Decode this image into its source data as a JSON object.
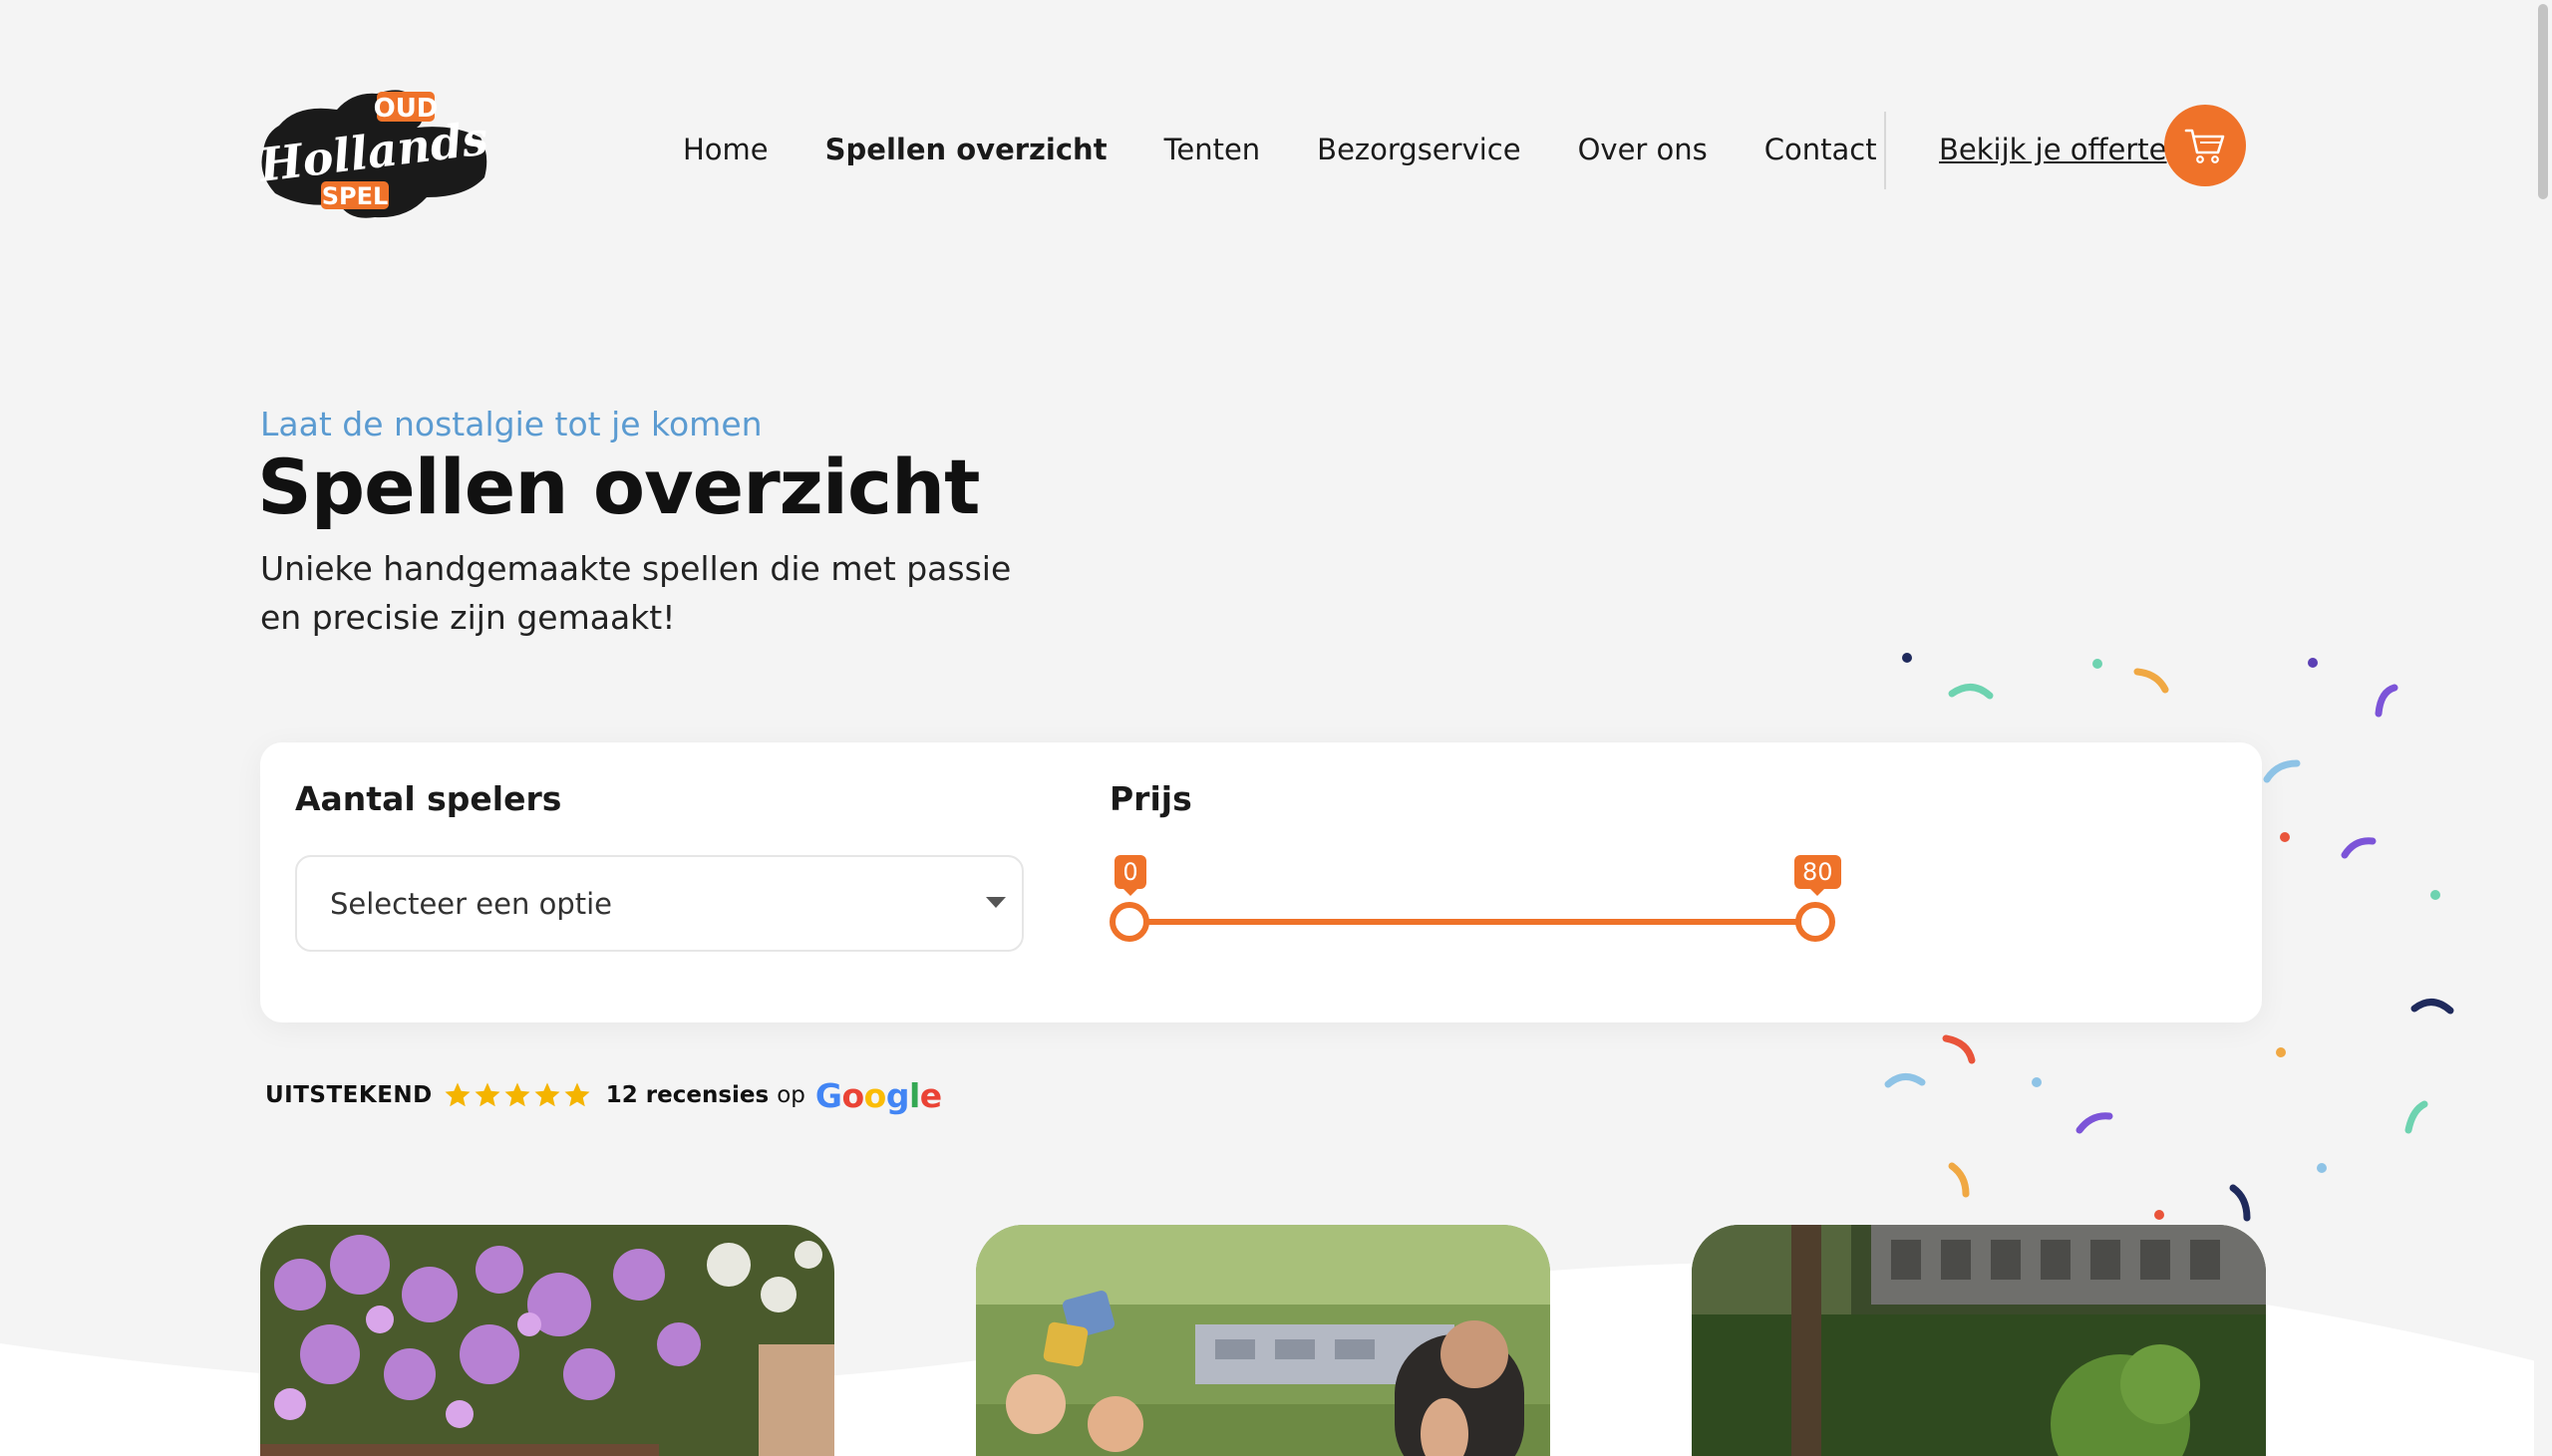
{
  "header": {
    "logo": {
      "line1": "OUD",
      "line2": "Hollands",
      "line3": "SPEL"
    },
    "nav": [
      {
        "label": "Home",
        "active": false
      },
      {
        "label": "Spellen overzicht",
        "active": true
      },
      {
        "label": "Tenten",
        "active": false
      },
      {
        "label": "Bezorgservice",
        "active": false
      },
      {
        "label": "Over ons",
        "active": false
      },
      {
        "label": "Contact",
        "active": false
      }
    ],
    "offer_label": "Bekijk je offerte",
    "cart_icon": "shopping-cart-icon"
  },
  "hero": {
    "subtitle": "Laat de nostalgie tot je komen",
    "title": "Spellen overzicht",
    "description": "Unieke handgemaakte spellen die met passie en precisie zijn gemaakt!"
  },
  "filters": {
    "players": {
      "label": "Aantal spelers",
      "placeholder": "Selecteer een optie"
    },
    "price": {
      "label": "Prijs",
      "min": "0",
      "max": "80"
    }
  },
  "reviews": {
    "rating_label": "UITSTEKEND",
    "stars": 5,
    "count_label": "12 recensies",
    "on_label": "op",
    "provider": [
      "G",
      "o",
      "o",
      "g",
      "l",
      "e"
    ]
  },
  "colors": {
    "accent": "#ef7229",
    "subtitle_blue": "#5b9bd1",
    "background": "#f4f4f4",
    "star": "#f4b400",
    "google": [
      "#4285f4",
      "#ea4335",
      "#fbbc05",
      "#4285f4",
      "#34a853",
      "#ea4335"
    ]
  }
}
